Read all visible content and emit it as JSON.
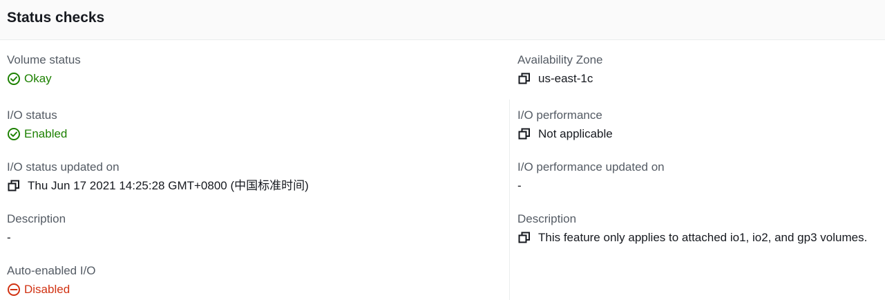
{
  "panel": {
    "title": "Status checks"
  },
  "left": {
    "volume_status": {
      "label": "Volume status",
      "value": "Okay",
      "icon": "status-positive-icon",
      "color": "#1d8102"
    },
    "io_status": {
      "label": "I/O status",
      "value": "Enabled",
      "icon": "status-positive-icon",
      "color": "#1d8102"
    },
    "io_status_updated": {
      "label": "I/O status updated on",
      "value": "Thu Jun 17 2021 14:25:28 GMT+0800 (中国标准时间)",
      "icon": "copy-icon"
    },
    "description": {
      "label": "Description",
      "value": "-"
    },
    "auto_enabled_io": {
      "label": "Auto-enabled I/O",
      "value": "Disabled",
      "icon": "status-negative-icon",
      "color": "#d13212"
    }
  },
  "right": {
    "availability_zone": {
      "label": "Availability Zone",
      "value": "us-east-1c",
      "icon": "copy-icon"
    },
    "io_performance": {
      "label": "I/O performance",
      "value": "Not applicable",
      "icon": "copy-icon"
    },
    "io_performance_updated": {
      "label": "I/O performance updated on",
      "value": "-"
    },
    "description": {
      "label": "Description",
      "value": "This feature only applies to attached io1, io2, and gp3 volumes.",
      "icon": "copy-icon"
    }
  }
}
